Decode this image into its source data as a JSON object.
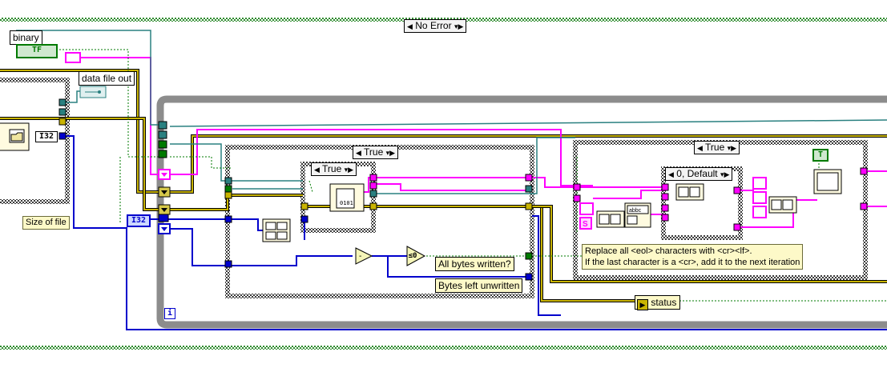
{
  "labels": {
    "binary": "binary",
    "data_file_out": "data file out",
    "size_of_file": "Size of file",
    "all_bytes_written": "All bytes written?",
    "bytes_left_unwritten": "Bytes left unwritten",
    "status": "status",
    "comment_line1": "Replace all <eol> characters with <cr><lf>.",
    "comment_line2": "If the last character is a <cr>, add it to the next iteration"
  },
  "selectors": {
    "outer_case": "No Error",
    "inner_case_1": "True",
    "inner_case_2": "True",
    "inner_case_3": "True",
    "inner_case_4": "0, Default"
  },
  "constants": {
    "bool_tf": "TF",
    "i32_a": "I32",
    "i32_b": "I32",
    "bool_true": "T",
    "zero_compare": "≤0",
    "loop_iteration": "i"
  },
  "colors": {
    "wire_error": "#c9b400",
    "wire_string": "#ff00ff",
    "wire_int": "#0000cc",
    "wire_ref": "#2a8080",
    "wire_bool": "#007a00",
    "structure_frame": "#8c8c8c",
    "case_frame": "#505050"
  }
}
